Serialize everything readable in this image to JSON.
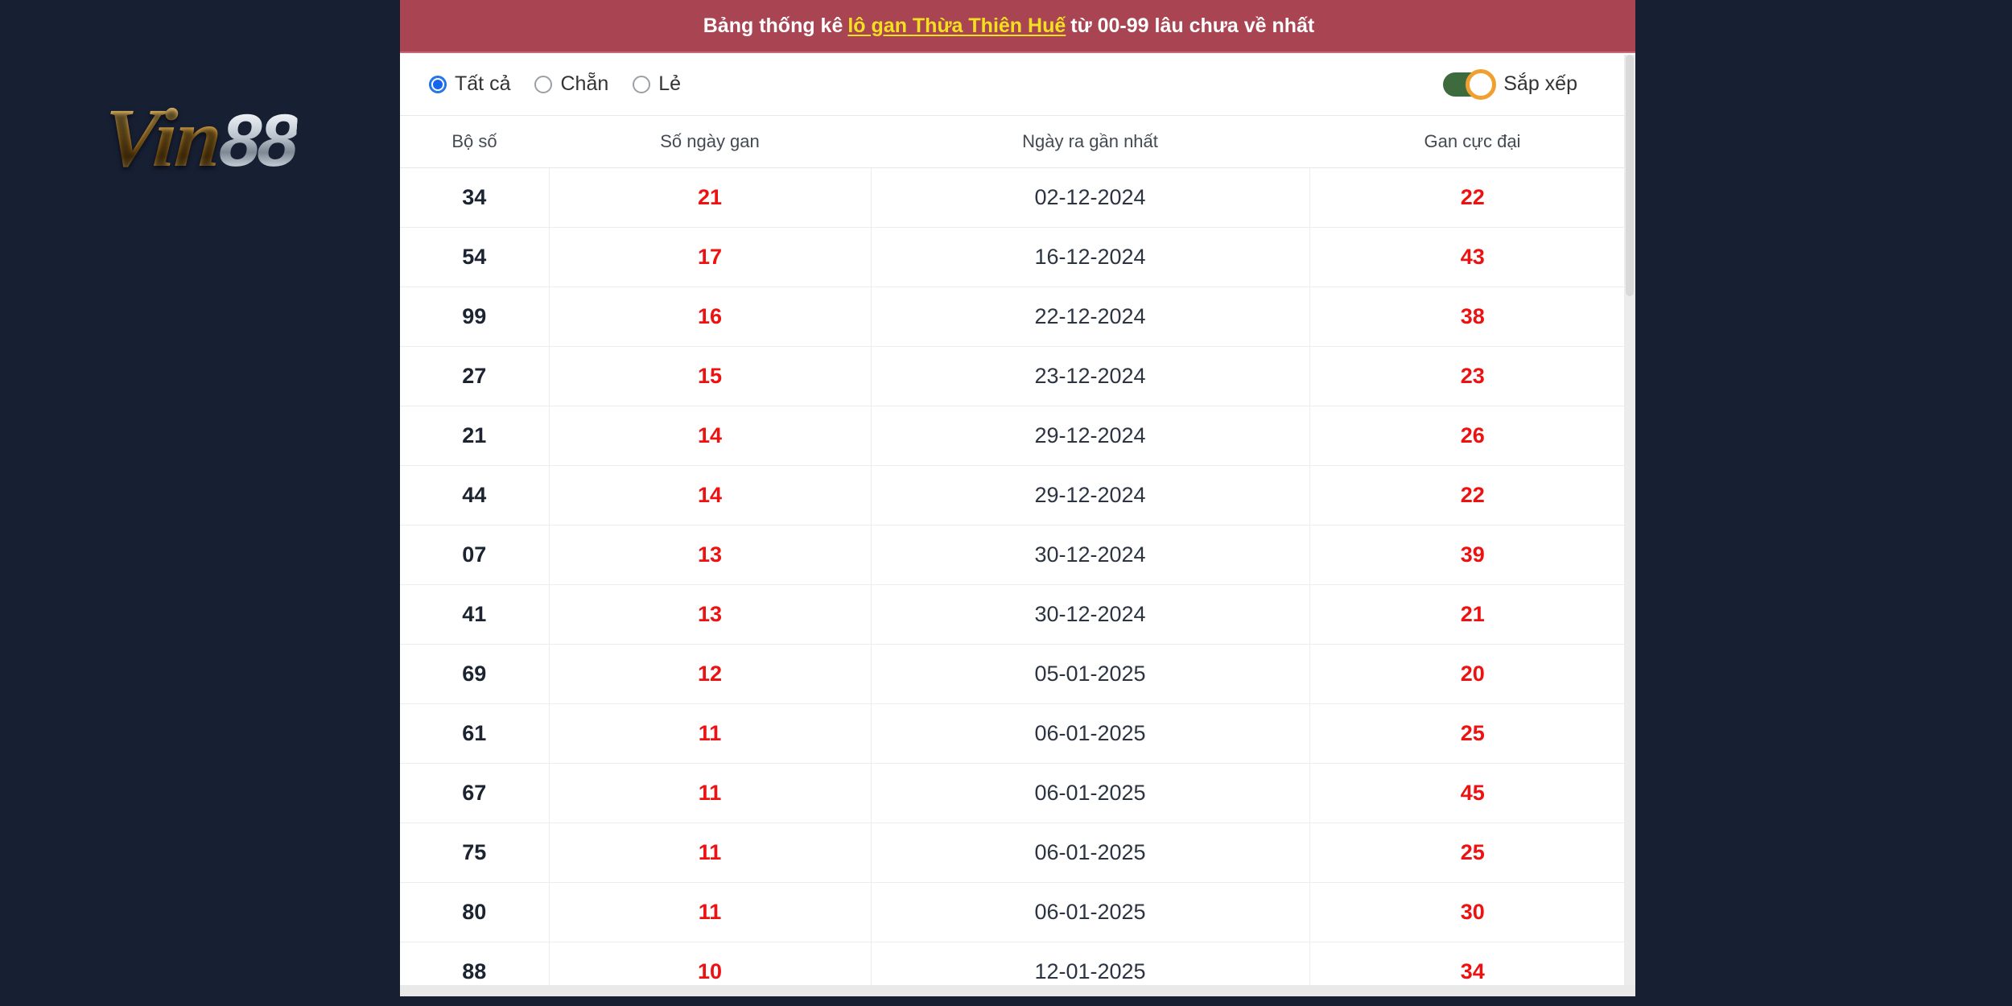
{
  "brand": {
    "logo_primary": "Vin",
    "logo_secondary": "88"
  },
  "panel": {
    "header": {
      "prefix": "Bảng thống kê",
      "link": "lô gan Thừa Thiên Huế",
      "suffix": "từ 00-99 lâu chưa về nhất",
      "background_color": "#a94452",
      "link_color": "#f5e020"
    },
    "filters": {
      "radios": [
        {
          "label": "Tất cả",
          "checked": true
        },
        {
          "label": "Chẵn",
          "checked": false
        },
        {
          "label": "Lẻ",
          "checked": false
        }
      ],
      "sort": {
        "label": "Sắp xếp",
        "enabled": true,
        "track_color": "#3d6b3e",
        "knob_ring_color": "#f0a030"
      }
    },
    "table": {
      "columns": [
        "Bộ số",
        "Số ngày gan",
        "Ngày ra gần nhất",
        "Gan cực đại"
      ],
      "accent_color": "#ee1111",
      "rows": [
        {
          "bo_so": "34",
          "so_ngay_gan": "21",
          "ngay_ra_gan_nhat": "02-12-2024",
          "gan_cuc_dai": "22"
        },
        {
          "bo_so": "54",
          "so_ngay_gan": "17",
          "ngay_ra_gan_nhat": "16-12-2024",
          "gan_cuc_dai": "43"
        },
        {
          "bo_so": "99",
          "so_ngay_gan": "16",
          "ngay_ra_gan_nhat": "22-12-2024",
          "gan_cuc_dai": "38"
        },
        {
          "bo_so": "27",
          "so_ngay_gan": "15",
          "ngay_ra_gan_nhat": "23-12-2024",
          "gan_cuc_dai": "23"
        },
        {
          "bo_so": "21",
          "so_ngay_gan": "14",
          "ngay_ra_gan_nhat": "29-12-2024",
          "gan_cuc_dai": "26"
        },
        {
          "bo_so": "44",
          "so_ngay_gan": "14",
          "ngay_ra_gan_nhat": "29-12-2024",
          "gan_cuc_dai": "22"
        },
        {
          "bo_so": "07",
          "so_ngay_gan": "13",
          "ngay_ra_gan_nhat": "30-12-2024",
          "gan_cuc_dai": "39"
        },
        {
          "bo_so": "41",
          "so_ngay_gan": "13",
          "ngay_ra_gan_nhat": "30-12-2024",
          "gan_cuc_dai": "21"
        },
        {
          "bo_so": "69",
          "so_ngay_gan": "12",
          "ngay_ra_gan_nhat": "05-01-2025",
          "gan_cuc_dai": "20"
        },
        {
          "bo_so": "61",
          "so_ngay_gan": "11",
          "ngay_ra_gan_nhat": "06-01-2025",
          "gan_cuc_dai": "25"
        },
        {
          "bo_so": "67",
          "so_ngay_gan": "11",
          "ngay_ra_gan_nhat": "06-01-2025",
          "gan_cuc_dai": "45"
        },
        {
          "bo_so": "75",
          "so_ngay_gan": "11",
          "ngay_ra_gan_nhat": "06-01-2025",
          "gan_cuc_dai": "25"
        },
        {
          "bo_so": "80",
          "so_ngay_gan": "11",
          "ngay_ra_gan_nhat": "06-01-2025",
          "gan_cuc_dai": "30"
        },
        {
          "bo_so": "88",
          "so_ngay_gan": "10",
          "ngay_ra_gan_nhat": "12-01-2025",
          "gan_cuc_dai": "34"
        }
      ]
    }
  }
}
